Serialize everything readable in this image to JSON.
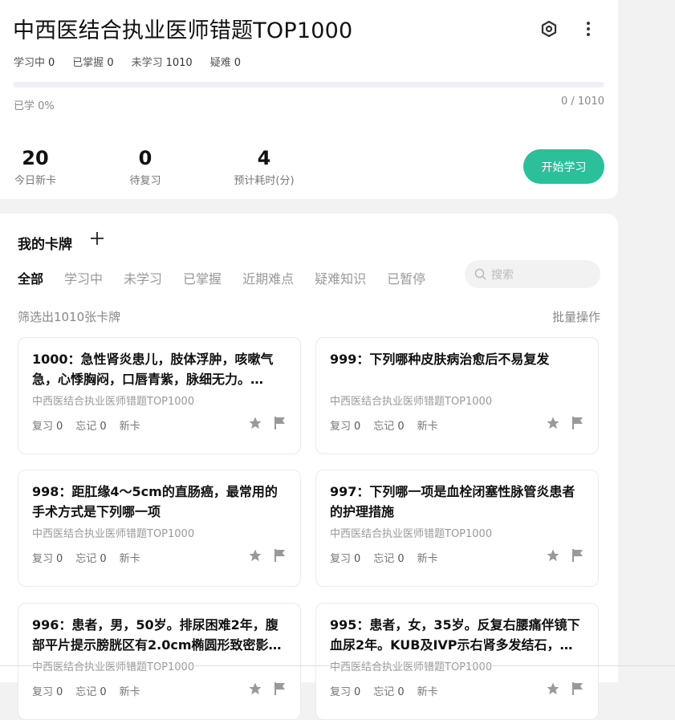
{
  "deck": {
    "title": "中西医结合执业医师错题TOP1000",
    "stats": [
      {
        "label": "学习中",
        "value": "0"
      },
      {
        "label": "已掌握",
        "value": "0"
      },
      {
        "label": "未学习",
        "value": "1010"
      },
      {
        "label": "疑难",
        "value": "0"
      }
    ],
    "progress_fraction": 0,
    "progress_left": "已学 0%",
    "progress_right": "0 / 1010",
    "metrics": [
      {
        "value": "20",
        "label": "今日新卡"
      },
      {
        "value": "0",
        "label": "待复习"
      },
      {
        "value": "4",
        "label": "预计耗时(分)"
      }
    ],
    "start_label": "开始学习",
    "icons": {
      "settings": "hexagon-settings-icon",
      "more": "more-vertical-icon"
    }
  },
  "my_cards": {
    "title": "我的卡牌",
    "add_icon": "plus-icon",
    "tabs": [
      "全部",
      "学习中",
      "未学习",
      "已掌握",
      "近期难点",
      "疑难知识",
      "已暂停"
    ],
    "active_tab": "全部",
    "search_placeholder": "搜索",
    "filter_text": "筛选出1010张卡牌",
    "batch_label": "批量操作"
  },
  "cards": [
    {
      "question": "1000：急性肾炎患儿，肢体浮肿，咳嗽气急，心悸胸闷，口唇青紫，脉细无力。…",
      "source": "中西医结合执业医师错题TOP1000",
      "review_label": "复习",
      "review": "0",
      "forget_label": "忘记",
      "forget": "0",
      "status": "新卡"
    },
    {
      "question": "999：下列哪种皮肤病治愈后不易复发",
      "source": "中西医结合执业医师错题TOP1000",
      "review_label": "复习",
      "review": "0",
      "forget_label": "忘记",
      "forget": "0",
      "status": "新卡"
    },
    {
      "question": "998：距肛缘4～5cm的直肠癌，最常用的手术方式是下列哪一项",
      "source": "中西医结合执业医师错题TOP1000",
      "review_label": "复习",
      "review": "0",
      "forget_label": "忘记",
      "forget": "0",
      "status": "新卡"
    },
    {
      "question": "997：下列哪一项是血栓闭塞性脉管炎患者的护理措施",
      "source": "中西医结合执业医师错题TOP1000",
      "review_label": "复习",
      "review": "0",
      "forget_label": "忘记",
      "forget": "0",
      "status": "新卡"
    },
    {
      "question": "996：患者，男，50岁。排尿困难2年，腹部平片提示膀胱区有2.0cm椭圆形致密影…",
      "source": "中西医结合执业医师错题TOP1000",
      "review_label": "复习",
      "review": "0",
      "forget_label": "忘记",
      "forget": "0",
      "status": "新卡"
    },
    {
      "question": "995：患者，女，35岁。反复右腰痛伴镜下血尿2年。KUB及IVP示右肾多发结石，…",
      "source": "中西医结合执业医师错题TOP1000",
      "review_label": "复习",
      "review": "0",
      "forget_label": "忘记",
      "forget": "0",
      "status": "新卡"
    }
  ]
}
